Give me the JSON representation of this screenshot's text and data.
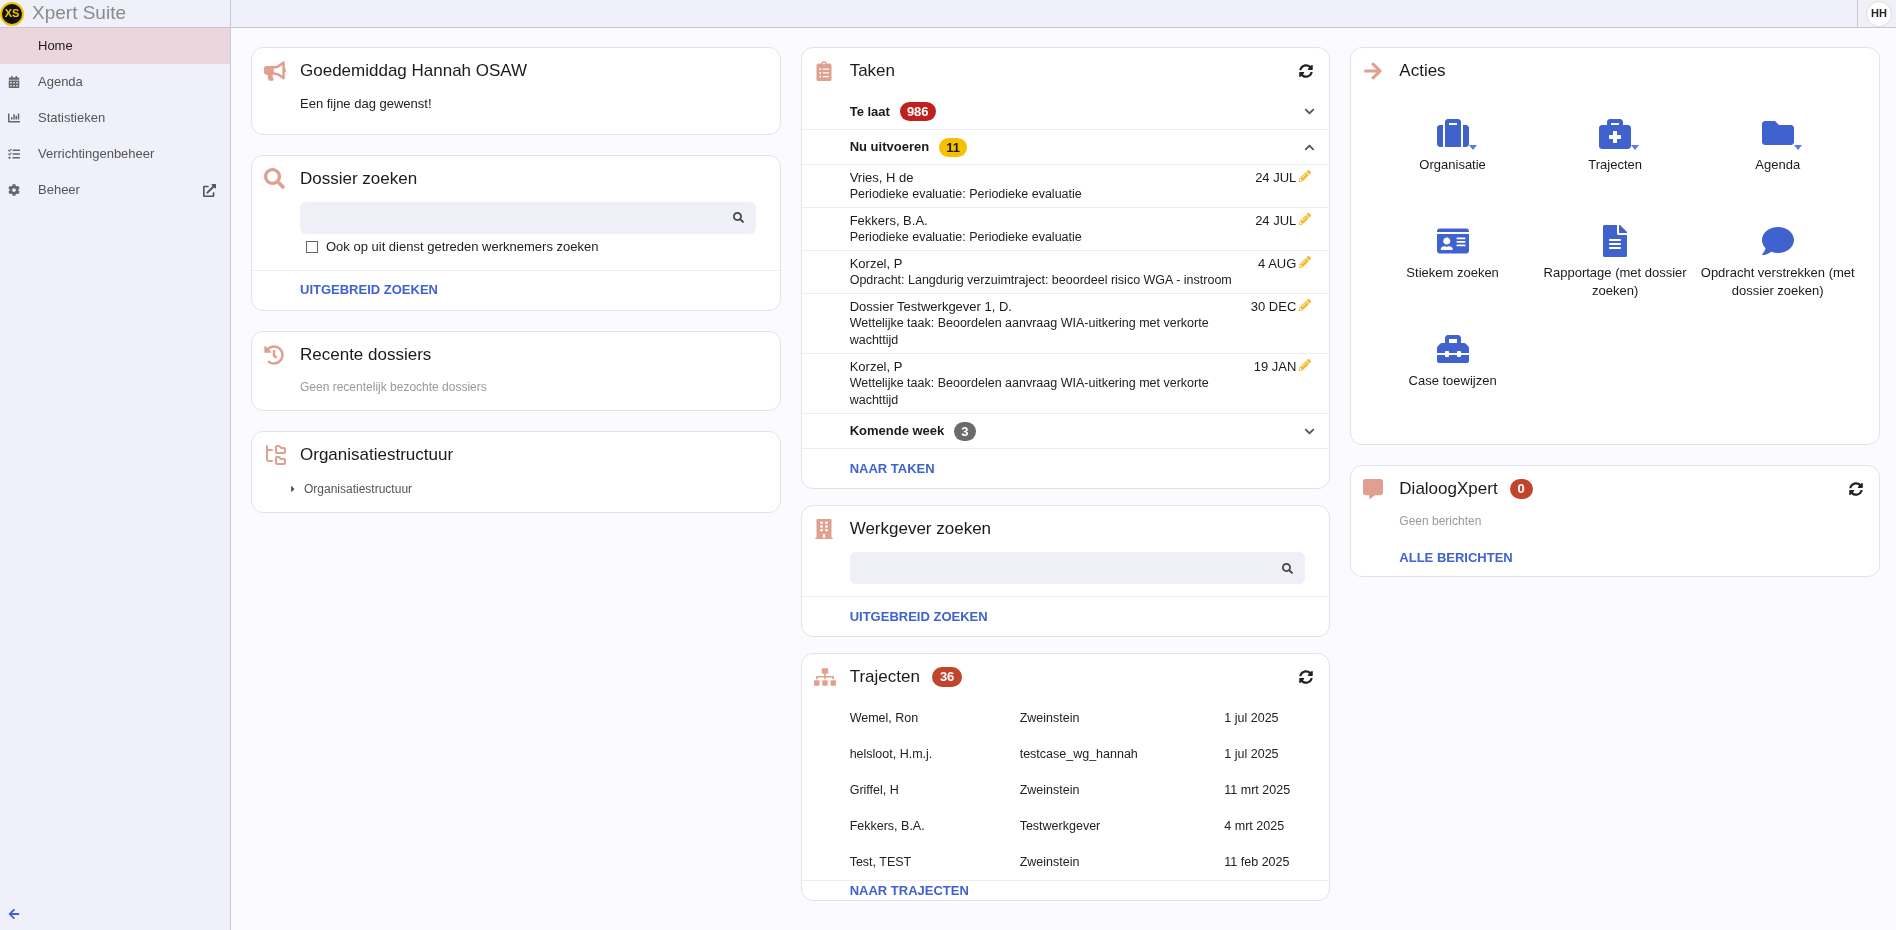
{
  "app": {
    "logo": "XS",
    "title": "Xpert Suite",
    "user_initials": "HH"
  },
  "sidebar": {
    "items": [
      {
        "label": "Home",
        "selected": true,
        "external": false
      },
      {
        "label": "Agenda",
        "selected": false,
        "external": false
      },
      {
        "label": "Statistieken",
        "selected": false,
        "external": false
      },
      {
        "label": "Verrichtingenbeheer",
        "selected": false,
        "external": false
      },
      {
        "label": "Beheer",
        "selected": false,
        "external": true
      }
    ]
  },
  "greeting": {
    "title": "Goedemiddag Hannah OSAW",
    "text": "Een fijne dag gewenst!"
  },
  "dossier_search": {
    "title": "Dossier zoeken",
    "checkbox": {
      "label": "Ook op uit dienst getreden werknemers zoeken",
      "checked": false
    },
    "link": "UITGEBREID ZOEKEN"
  },
  "recent": {
    "title": "Recente dossiers",
    "empty_text": "Geen recentelijk bezochte dossiers"
  },
  "org": {
    "title": "Organisatiestructuur",
    "tree": [
      {
        "label": "Organisatiestructuur",
        "expanded": false
      }
    ]
  },
  "tasks": {
    "title": "Taken",
    "groups": [
      {
        "label": "Te laat",
        "count": "986",
        "color": "#c0211f",
        "expanded": false
      },
      {
        "label": "Nu uitvoeren",
        "count": "11",
        "color": "#f6c000",
        "expanded": true,
        "items": [
          {
            "name": "Vries, H de",
            "description": "Periodieke evaluatie: Periodieke evaluatie",
            "date": "24 JUL"
          },
          {
            "name": "Fekkers, B.A.",
            "description": "Periodieke evaluatie: Periodieke evaluatie",
            "date": "24 JUL"
          },
          {
            "name": "Korzel, P",
            "description": "Opdracht: Langdurig verzuimtraject: beoordeel risico WGA - instroom",
            "date": "4 AUG"
          },
          {
            "name": "Dossier Testwerkgever 1, D.",
            "description": "Wettelijke taak: Beoordelen aanvraag WIA-uitkering met verkorte wachttijd",
            "date": "30 DEC"
          },
          {
            "name": "Korzel, P",
            "description": "Wettelijke taak: Beoordelen aanvraag WIA-uitkering met verkorte wachttijd",
            "date": "19 JAN"
          }
        ]
      },
      {
        "label": "Komende week",
        "count": "3",
        "color": "#6b6b6b",
        "expanded": false
      }
    ],
    "link": "NAAR TAKEN"
  },
  "employer_search": {
    "title": "Werkgever zoeken",
    "link": "UITGEBREID ZOEKEN"
  },
  "trajects": {
    "title": "Trajecten",
    "count": "36",
    "rows": [
      {
        "name": "Wemel, Ron",
        "employer": "Zweinstein",
        "date": "1 jul 2025"
      },
      {
        "name": "helsloot, H.m.j.",
        "employer": "testcase_wg_hannah",
        "date": "1 jul 2025"
      },
      {
        "name": "Griffel, H",
        "employer": "Zweinstein",
        "date": "11 mrt 2025"
      },
      {
        "name": "Fekkers, B.A.",
        "employer": "Testwerkgever",
        "date": "4 mrt 2025"
      },
      {
        "name": "Test, TEST",
        "employer": "Zweinstein",
        "date": "11 feb 2025"
      }
    ],
    "link": "NAAR TRAJECTEN"
  },
  "actions": {
    "title": "Acties",
    "items": [
      {
        "label": "Organisatie",
        "has_menu": true
      },
      {
        "label": "Trajecten",
        "has_menu": true
      },
      {
        "label": "Agenda",
        "has_menu": true
      },
      {
        "label": "Stiekem zoeken",
        "has_menu": false
      },
      {
        "label": "Rapportage (met dossier zoeken)",
        "has_menu": false
      },
      {
        "label": "Opdracht verstrekken (met dossier zoeken)",
        "has_menu": false
      },
      {
        "label": "Case toewijzen",
        "has_menu": false
      }
    ]
  },
  "dialog": {
    "title": "DialoogXpert",
    "count": "0",
    "empty_text": "Geen berichten",
    "link": "ALLE BERICHTEN"
  }
}
